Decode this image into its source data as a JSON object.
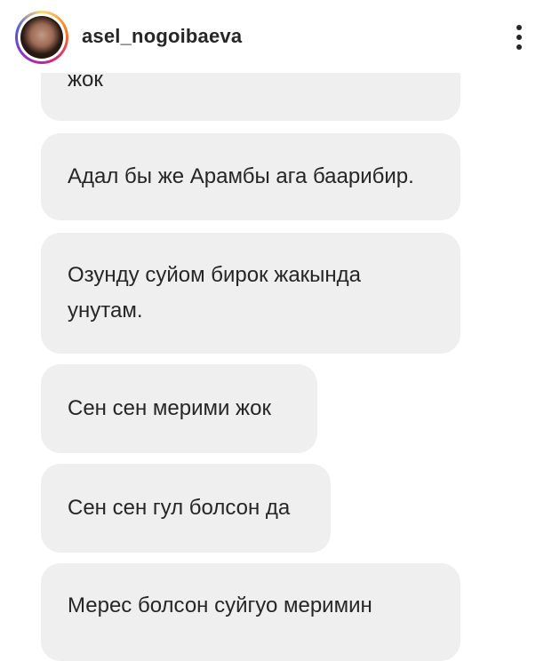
{
  "header": {
    "username": "asel_nogoibaeva",
    "more_icon": "more-vertical-icon"
  },
  "messages": [
    {
      "text": "жок"
    },
    {
      "text": "Адал бы же Арамбы ага баарибир."
    },
    {
      "text": "Озунду суйом бирок жакында унутам."
    },
    {
      "text": "Сен сен мерими жок"
    },
    {
      "text": "Сен сен гул болсон да"
    },
    {
      "text": "Мерес болсон суйгуо меримин"
    }
  ]
}
